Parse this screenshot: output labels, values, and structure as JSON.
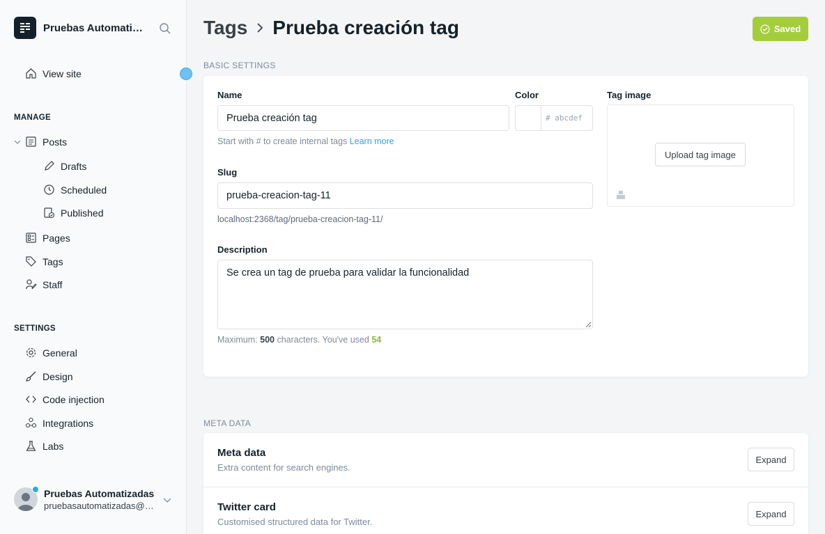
{
  "sidebar": {
    "site_title": "Pruebas Automatizadas",
    "view_site": "View site",
    "manage_heading": "MANAGE",
    "posts": "Posts",
    "drafts": "Drafts",
    "scheduled": "Scheduled",
    "published": "Published",
    "pages": "Pages",
    "tags": "Tags",
    "staff": "Staff",
    "settings_heading": "SETTINGS",
    "general": "General",
    "design": "Design",
    "code_injection": "Code injection",
    "integrations": "Integrations",
    "labs": "Labs",
    "user_name": "Pruebas Automatizadas",
    "user_email": "pruebasautomatizadas@uniandes.edu.co"
  },
  "header": {
    "breadcrumb_parent": "Tags",
    "breadcrumb_current": "Prueba creación tag",
    "saved_label": "Saved"
  },
  "basic": {
    "section_title": "Basic settings",
    "name_label": "Name",
    "name_value": "Prueba creación tag",
    "name_hint": "Start with # to create internal tags",
    "learn_more": "Learn more",
    "color_label": "Color",
    "color_placeholder": "# abcdef",
    "tag_image_label": "Tag image",
    "upload_label": "Upload tag image",
    "slug_label": "Slug",
    "slug_value": "prueba-creacion-tag-11",
    "slug_url": "localhost:2368/tag/prueba-creacion-tag-11/",
    "description_label": "Description",
    "description_value": "Se crea un tag de prueba para validar la funcionalidad",
    "desc_hint_prefix": "Maximum:",
    "desc_max": "500",
    "desc_hint_mid": "characters. You've used",
    "desc_used": "54"
  },
  "meta": {
    "section_title": "Meta data",
    "rows": [
      {
        "title": "Meta data",
        "subtitle": "Extra content for search engines.",
        "button": "Expand"
      },
      {
        "title": "Twitter card",
        "subtitle": "Customised structured data for Twitter.",
        "button": "Expand"
      }
    ]
  },
  "colors": {
    "accent_green": "#a4cd3d",
    "link_blue": "#30a6e8",
    "count_green": "#8cb83e"
  }
}
